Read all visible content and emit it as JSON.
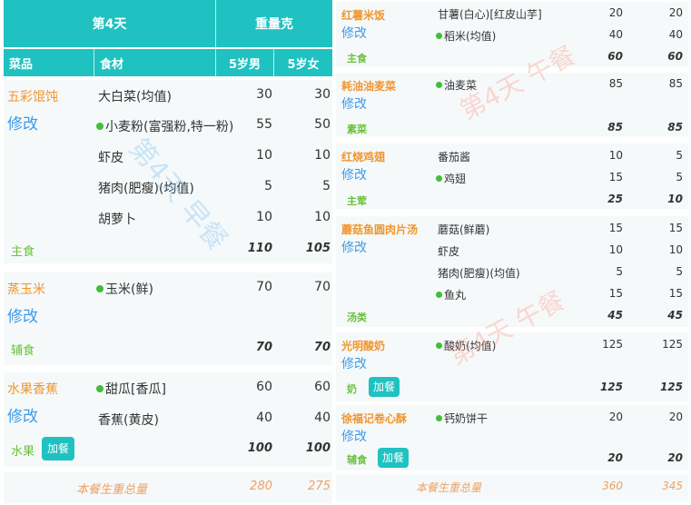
{
  "left": {
    "header": {
      "day": "第4天",
      "weight_header": "重量克",
      "col_dish": "菜品",
      "col_ingredient": "食材",
      "col_boy": "5岁男",
      "col_girl": "5岁女"
    },
    "dishes": [
      {
        "name": "五彩馄饨",
        "edit": "修改",
        "category": "主食",
        "ingredients": [
          {
            "name": "大白菜(均值)",
            "dot": false,
            "boy": "30",
            "girl": "30"
          },
          {
            "name": "小麦粉(富强粉,特一粉)",
            "dot": true,
            "boy": "55",
            "girl": "50"
          },
          {
            "name": "虾皮",
            "dot": false,
            "boy": "10",
            "girl": "10"
          },
          {
            "name": "猪肉(肥瘦)(均值)",
            "dot": false,
            "boy": "5",
            "girl": "5"
          },
          {
            "name": "胡萝卜",
            "dot": false,
            "boy": "10",
            "girl": "10"
          }
        ],
        "total_boy": "110",
        "total_girl": "105"
      },
      {
        "name": "蒸玉米",
        "edit": "修改",
        "category": "辅食",
        "ingredients": [
          {
            "name": "玉米(鲜)",
            "dot": true,
            "boy": "70",
            "girl": "70"
          }
        ],
        "total_boy": "70",
        "total_girl": "70"
      },
      {
        "name": "水果香蕉",
        "edit": "修改",
        "category": "水果",
        "add_label": "加餐",
        "ingredients": [
          {
            "name": "甜瓜[香瓜]",
            "dot": true,
            "boy": "60",
            "girl": "60"
          },
          {
            "name": "香蕉(黄皮)",
            "dot": false,
            "boy": "40",
            "girl": "40"
          }
        ],
        "total_boy": "100",
        "total_girl": "100"
      }
    ],
    "footer": {
      "label": "本餐生重总量",
      "boy": "280",
      "girl": "275"
    },
    "watermark": "第4天 早餐"
  },
  "right": {
    "dishes": [
      {
        "name": "红薯米饭",
        "edit": "修改",
        "category": "主食",
        "ingredients": [
          {
            "name": "甘薯(白心)[红皮山芋]",
            "dot": false,
            "boy": "20",
            "girl": "20"
          },
          {
            "name": "稻米(均值)",
            "dot": true,
            "boy": "40",
            "girl": "40"
          }
        ],
        "total_boy": "60",
        "total_girl": "60"
      },
      {
        "name": "耗油油麦菜",
        "edit": "修改",
        "category": "素菜",
        "ingredients": [
          {
            "name": "油麦菜",
            "dot": true,
            "boy": "85",
            "girl": "85"
          }
        ],
        "total_boy": "85",
        "total_girl": "85"
      },
      {
        "name": "红烧鸡翅",
        "edit": "修改",
        "category": "主荤",
        "ingredients": [
          {
            "name": "番茄酱",
            "dot": false,
            "boy": "10",
            "girl": "5"
          },
          {
            "name": "鸡翅",
            "dot": true,
            "boy": "15",
            "girl": "5"
          }
        ],
        "total_boy": "25",
        "total_girl": "10"
      },
      {
        "name": "蘑菇鱼圆肉片汤",
        "edit": "修改",
        "category": "汤类",
        "ingredients": [
          {
            "name": "蘑菇(鲜蘑)",
            "dot": false,
            "boy": "15",
            "girl": "15"
          },
          {
            "name": "虾皮",
            "dot": false,
            "boy": "10",
            "girl": "10"
          },
          {
            "name": "猪肉(肥瘦)(均值)",
            "dot": false,
            "boy": "5",
            "girl": "5"
          },
          {
            "name": "鱼丸",
            "dot": true,
            "boy": "15",
            "girl": "15"
          }
        ],
        "total_boy": "45",
        "total_girl": "45"
      },
      {
        "name": "光明酸奶",
        "edit": "修改",
        "category": "奶",
        "add_label": "加餐",
        "ingredients": [
          {
            "name": "酸奶(均值)",
            "dot": true,
            "boy": "125",
            "girl": "125"
          }
        ],
        "total_boy": "125",
        "total_girl": "125"
      },
      {
        "name": "徐福记卷心酥",
        "edit": "修改",
        "category": "辅食",
        "add_label": "加餐",
        "ingredients": [
          {
            "name": "钙奶饼干",
            "dot": true,
            "boy": "20",
            "girl": "20"
          }
        ],
        "total_boy": "20",
        "total_girl": "20"
      }
    ],
    "footer": {
      "label": "本餐生重总量",
      "boy": "360",
      "girl": "345"
    },
    "watermark": "第4天 午餐"
  }
}
